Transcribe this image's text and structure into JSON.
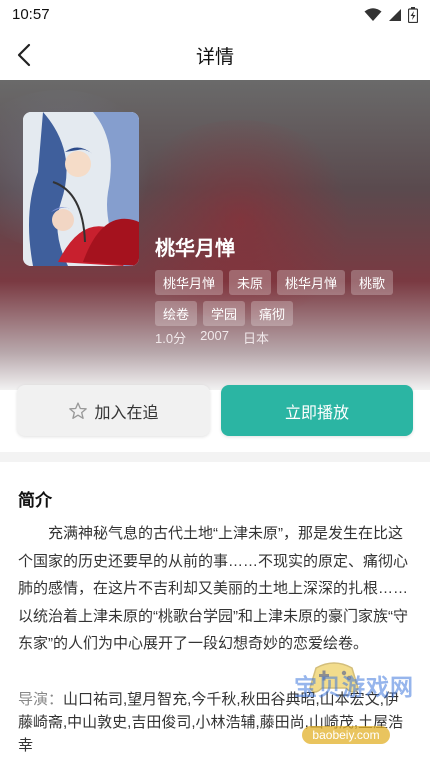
{
  "status_bar": {
    "time": "10:57"
  },
  "header": {
    "title": "详情"
  },
  "show": {
    "title": "桃华月惮",
    "tags": [
      "桃华月惮",
      "未原",
      "桃华月惮",
      "桃歌",
      "绘卷",
      "学园",
      "痛彻"
    ],
    "score": "1.0分",
    "year": "2007",
    "region": "日本"
  },
  "actions": {
    "follow_label": "加入在追",
    "play_label": "立即播放"
  },
  "intro": {
    "title": "简介",
    "text": "充满神秘气息的古代土地“上津未原”，那是发生在比这个国家的历史还要早的从前的事……不现实的原定、痛彻心肺的感情，在这片不吉利却又美丽的土地上深深的扎根……以统治着上津未原的“桃歌台学园”和上津未原的豪门家族“守东家”的人们为中心展开了一段幻想奇妙的恋爱绘卷。",
    "cast_label": "导演：",
    "cast_text": "山口祐司,望月智充,今千秋,秋田谷典昭,山本宏文,伊藤崎斋,中山敦史,吉田俊司,小林浩辅,藤田尚,山崎茂,土屋浩幸"
  },
  "watermark": {
    "text": "宝贝游戏网",
    "url": "baobeiy.com"
  },
  "colors": {
    "accent": "#2bb5a3",
    "star_outline": "#999999"
  }
}
